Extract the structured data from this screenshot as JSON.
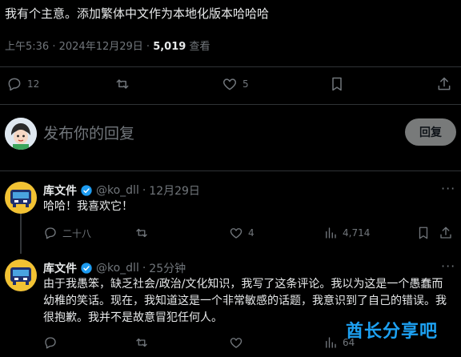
{
  "tweet": {
    "text": "我有个主意。添加繁体中文作为本地化版本哈哈哈",
    "time": "上午5:36",
    "date": "2024年12月29日",
    "views_count": "5,019",
    "views_label": "查看",
    "replies": "12",
    "likes": "5"
  },
  "compose": {
    "placeholder": "发布你的回复",
    "button_label": "回复"
  },
  "replies": [
    {
      "name": "库文件",
      "handle": "@ko_dll",
      "time": "12月29日",
      "text": "哈哈！我喜欢它！",
      "replies": "二十八",
      "likes": "4",
      "views": "4,714"
    },
    {
      "name": "库文件",
      "handle": "@ko_dll",
      "time": "25分钟",
      "text": "由于我愚笨，缺乏社会/政治/文化知识，我写了这条评论。我以为这是一个愚蠢而幼稚的笑话。现在，我知道这是一个非常敏感的话题，我意识到了自己的错误。我很抱歉。我并不是故意冒犯任何人。",
      "views": "64"
    }
  ],
  "watermark": "酋长分享吧",
  "colors": {
    "background": "#000000",
    "text": "#e7e9ea",
    "muted": "#71767b",
    "divider": "#2f3336",
    "verified": "#1d9bf0",
    "reply_button": "#787a7a"
  }
}
